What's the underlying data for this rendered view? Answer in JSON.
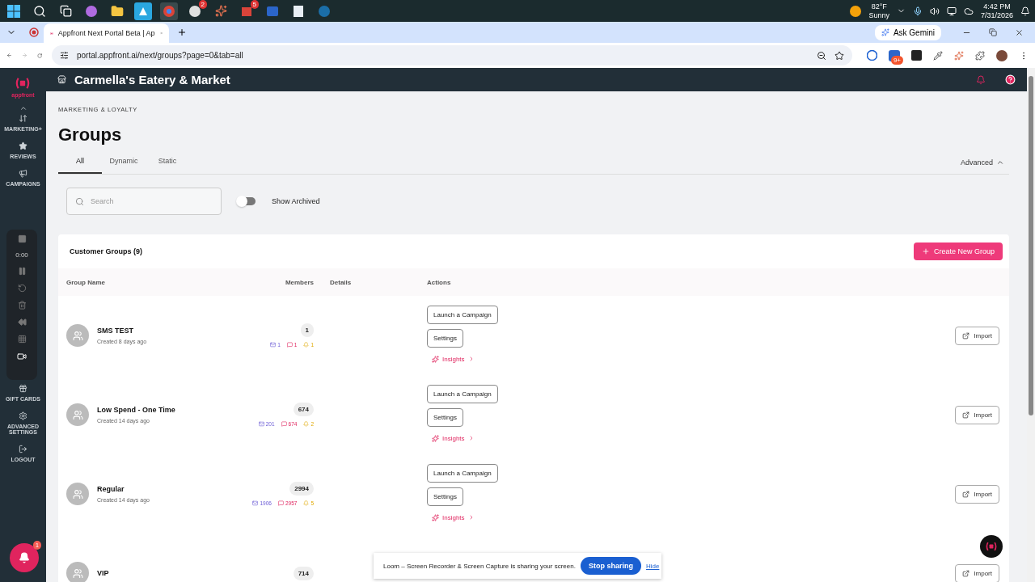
{
  "taskbar": {
    "badges": [
      "2",
      "5"
    ],
    "weather": {
      "temp": "82°F",
      "condition": "Sunny"
    },
    "time": "4:42 PM",
    "date": "7/31/2026"
  },
  "browser": {
    "tab_title": "Appfront Next Portal Beta | Ap",
    "url": "portal.appfront.ai/next/groups?page=0&tab=all",
    "ask_gemini": "Ask Gemini",
    "extension_badge": "9+"
  },
  "app_header": {
    "title": "Carmella's Eatery & Market"
  },
  "sidebar": {
    "logo": "appfront",
    "items": [
      {
        "label": "MARKETING+"
      },
      {
        "label": "REVIEWS"
      },
      {
        "label": "CAMPAIGNS"
      }
    ],
    "bottom_items": [
      {
        "label": "GIFT CARDS"
      },
      {
        "label": "ADVANCED SETTINGS"
      },
      {
        "label": "LOGOUT"
      }
    ],
    "notification_badge": "1"
  },
  "recorder": {
    "time": "0:00"
  },
  "page": {
    "breadcrumb": "MARKETING & LOYALTY",
    "title": "Groups",
    "advanced": "Advanced",
    "tabs": [
      {
        "label": "All",
        "selected": true
      },
      {
        "label": "Dynamic",
        "selected": false
      },
      {
        "label": "Static",
        "selected": false
      }
    ],
    "search": {
      "placeholder": "Search"
    },
    "show_archived": {
      "label": "Show Archived",
      "on": false
    }
  },
  "groups": {
    "title": "Customer Groups (9)",
    "create_button": "Create New Group",
    "columns": [
      "Group Name",
      "Members",
      "Details",
      "Actions"
    ],
    "rows": [
      {
        "name": "SMS TEST",
        "created": "Created 8 days ago",
        "members": "1",
        "email": "1",
        "sms": "1",
        "push": "1",
        "actions": [
          "Launch a Campaign",
          "Settings"
        ],
        "insights": "Insights",
        "import": "Import"
      },
      {
        "name": "Low Spend - One Time",
        "created": "Created 14 days ago",
        "members": "674",
        "email": "201",
        "sms": "674",
        "push": "2",
        "actions": [
          "Launch a Campaign",
          "Settings"
        ],
        "insights": "Insights",
        "import": "Import"
      },
      {
        "name": "Regular",
        "created": "Created 14 days ago",
        "members": "2994",
        "email": "1906",
        "sms": "2957",
        "push": "5",
        "actions": [
          "Launch a Campaign",
          "Settings"
        ],
        "insights": "Insights",
        "import": "Import"
      },
      {
        "name": "VIP",
        "members": "714",
        "import": "Import"
      }
    ]
  },
  "share_bar": {
    "text": "Loom – Screen Recorder & Screen Capture is sharing your screen.",
    "stop": "Stop sharing",
    "hide": "Hide"
  }
}
